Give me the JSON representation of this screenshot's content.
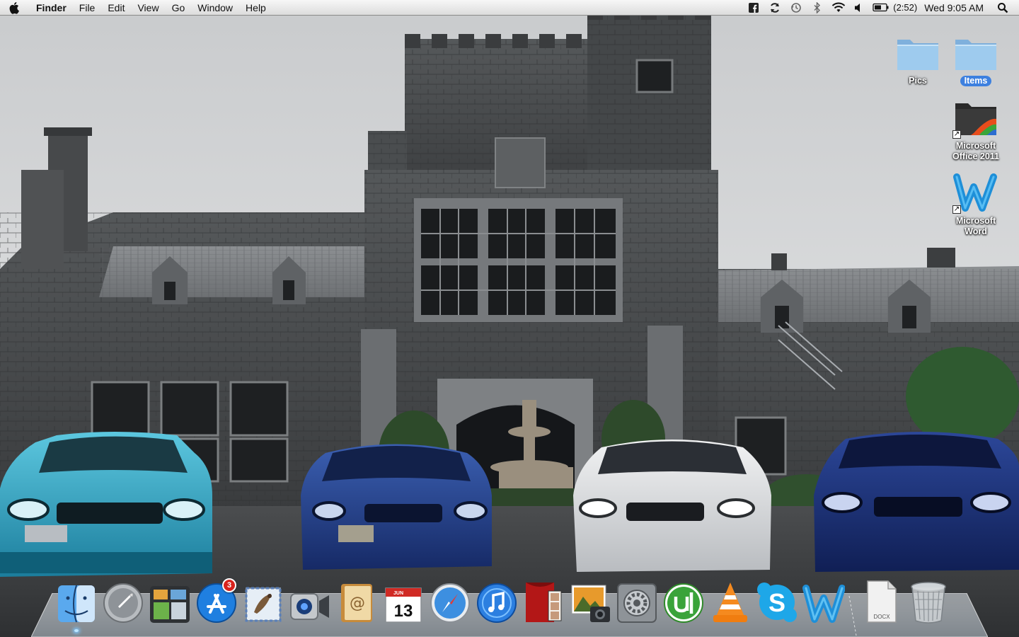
{
  "menubar": {
    "app_name": "Finder",
    "menus": [
      "File",
      "Edit",
      "View",
      "Go",
      "Window",
      "Help"
    ],
    "status_icons": [
      "facebook-icon",
      "sync-icon",
      "time-machine-icon",
      "bluetooth-icon",
      "wifi-icon",
      "volume-icon",
      "battery-icon",
      "spotlight-icon"
    ],
    "battery_time": "(2:52)",
    "clock": "Wed 9:05 AM"
  },
  "desktop": {
    "icons": [
      {
        "label": "Pics",
        "icon": "folder-icon",
        "selected": false
      },
      {
        "label": "Items",
        "icon": "folder-icon",
        "selected": true
      },
      {
        "label": "Microsoft Office 2011",
        "icon": "office-folder-icon",
        "alias": true
      },
      {
        "label": "Microsoft Word",
        "icon": "word-icon",
        "alias": true
      }
    ]
  },
  "dock": {
    "apps": [
      {
        "name": "Finder",
        "icon": "finder-icon",
        "running": true
      },
      {
        "name": "Launchpad",
        "icon": "launchpad-icon"
      },
      {
        "name": "Mission Control",
        "icon": "mission-control-icon"
      },
      {
        "name": "App Store",
        "icon": "app-store-icon",
        "badge": "3"
      },
      {
        "name": "Mail",
        "icon": "mail-icon"
      },
      {
        "name": "FaceTime",
        "icon": "facetime-icon"
      },
      {
        "name": "Address Book",
        "icon": "address-book-icon"
      },
      {
        "name": "iCal",
        "icon": "calendar-icon",
        "calendar_month": "JUN",
        "calendar_day": "13"
      },
      {
        "name": "Safari",
        "icon": "safari-icon"
      },
      {
        "name": "iTunes",
        "icon": "itunes-icon"
      },
      {
        "name": "Photo Booth",
        "icon": "photo-booth-icon"
      },
      {
        "name": "iPhoto",
        "icon": "iphoto-icon"
      },
      {
        "name": "System Preferences",
        "icon": "system-preferences-icon"
      },
      {
        "name": "uTorrent",
        "icon": "utorrent-icon"
      },
      {
        "name": "VLC",
        "icon": "vlc-icon"
      },
      {
        "name": "Skype",
        "icon": "skype-icon"
      },
      {
        "name": "Microsoft Word",
        "icon": "word-icon"
      }
    ],
    "stack_docx_label": "DOCX",
    "trash": "trash-icon"
  },
  "colors": {
    "menubar": "#e6e6e6",
    "selection": "#3d80df",
    "badge": "#d8231d"
  }
}
